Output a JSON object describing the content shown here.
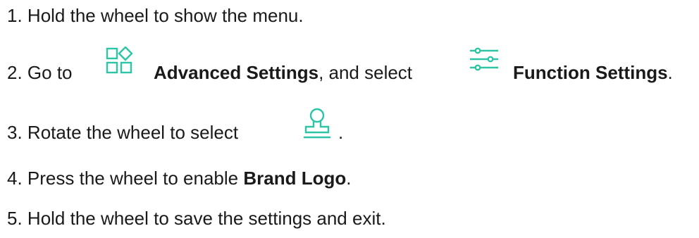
{
  "accent_color": "#2ec4a6",
  "steps": [
    {
      "number": "1.",
      "text": "Hold the wheel to show the menu."
    },
    {
      "number": "2.",
      "pre": "Go to",
      "icon1": "advanced-settings-icon",
      "bold1": "Advanced Settings",
      "mid": ", and select",
      "icon2": "function-settings-icon",
      "bold2": "Function Settings",
      "end": "."
    },
    {
      "number": "3.",
      "pre": "Rotate the wheel to select",
      "icon": "brand-logo-stamp-icon",
      "end": "."
    },
    {
      "number": "4.",
      "pre": "Press the wheel to enable",
      "bold": "Brand Logo",
      "end": "."
    },
    {
      "number": "5.",
      "text": "Hold the wheel to save the settings and exit."
    }
  ]
}
